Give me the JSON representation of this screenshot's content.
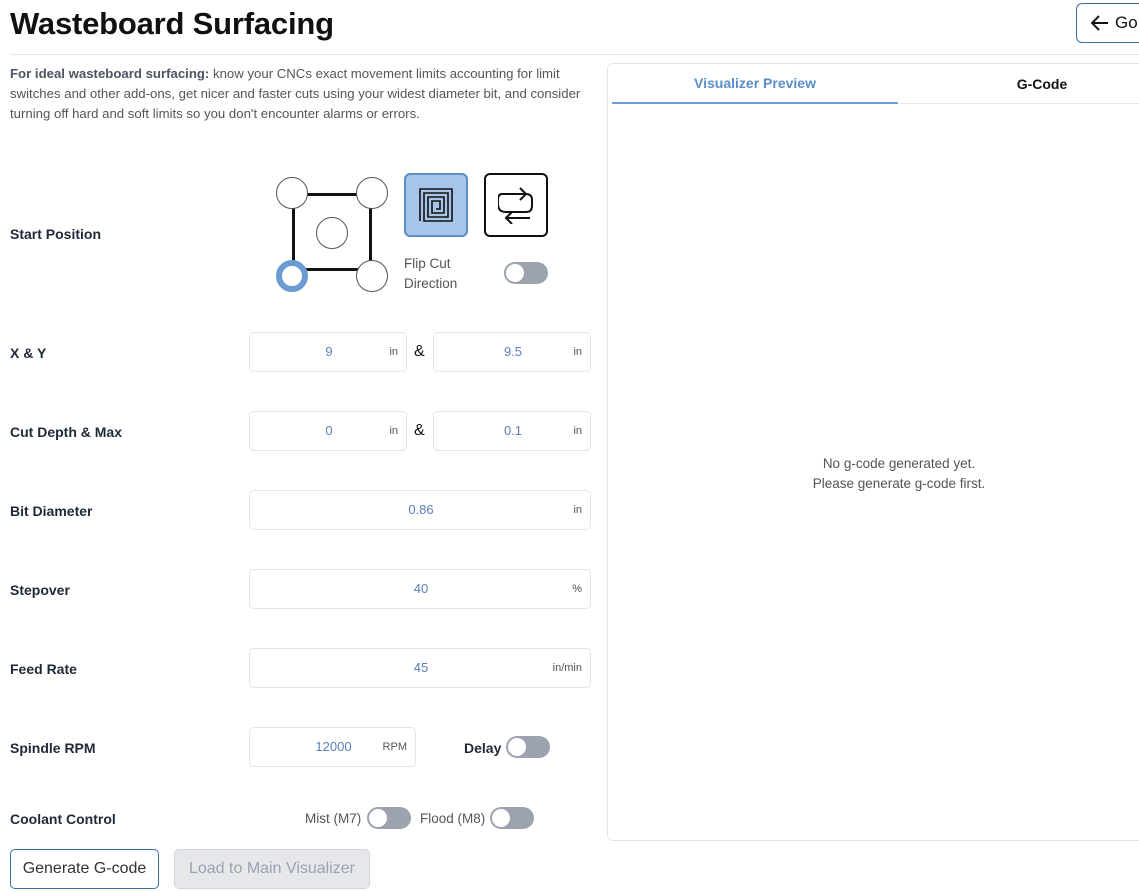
{
  "header": {
    "title": "Wasteboard Surfacing",
    "go_label": "Go"
  },
  "intro": {
    "bold": "For ideal wasteboard surfacing:",
    "text": " know your CNCs exact movement limits accounting for limit switches and other add-ons, get nicer and faster cuts using your widest diameter bit, and consider turning off hard and soft limits so you don't encounter alarms or errors."
  },
  "labels": {
    "start_position": "Start Position",
    "xy": "X & Y",
    "cut_depth": "Cut Depth & Max",
    "bit_diameter": "Bit Diameter",
    "stepover": "Stepover",
    "feed_rate": "Feed Rate",
    "spindle_rpm": "Spindle RPM",
    "coolant": "Coolant Control"
  },
  "start_position": {
    "flip_label_line1": "Flip Cut",
    "flip_label_line2": "Direction",
    "selected_corner": "bottom-left",
    "selected_mode": "spiral",
    "flip_enabled": false
  },
  "fields": {
    "x": {
      "value": "9",
      "unit": "in"
    },
    "y": {
      "value": "9.5",
      "unit": "in"
    },
    "cut_depth": {
      "value": "0",
      "unit": "in"
    },
    "cut_max": {
      "value": "0.1",
      "unit": "in"
    },
    "bit_diameter": {
      "value": "0.86",
      "unit": "in"
    },
    "stepover": {
      "value": "40",
      "unit": "%"
    },
    "feed_rate": {
      "value": "45",
      "unit": "in/min"
    },
    "spindle_rpm": {
      "value": "12000",
      "unit": "RPM"
    },
    "amp": "&"
  },
  "toggles": {
    "delay_label": "Delay",
    "delay": false,
    "mist_label": "Mist (M7)",
    "mist": false,
    "flood_label": "Flood (M8)",
    "flood": false
  },
  "buttons": {
    "generate": "Generate G-code",
    "load": "Load to Main Visualizer"
  },
  "panel": {
    "tabs": [
      "Visualizer Preview",
      "G-Code"
    ],
    "active_tab": "Visualizer Preview",
    "empty_line1": "No g-code generated yet.",
    "empty_line2": "Please generate g-code first."
  },
  "colors": {
    "accent": "#6b9bd2",
    "toggle_off": "#9ca3af",
    "value_text": "#5b7fb8"
  }
}
